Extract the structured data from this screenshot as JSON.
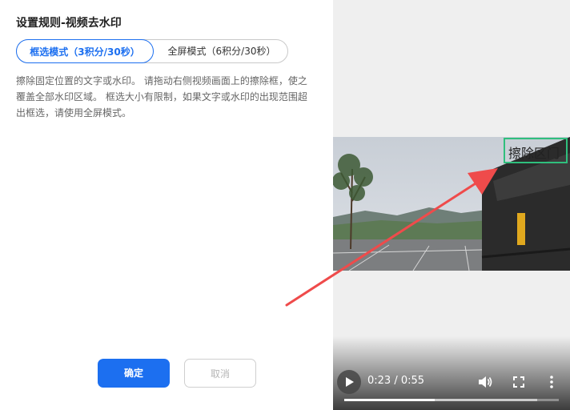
{
  "panel": {
    "title": "设置规则-视频去水印",
    "modes": [
      {
        "label": "框选模式（3积分/30秒）",
        "active": true
      },
      {
        "label": "全屏模式（6积分/30秒）",
        "active": false
      }
    ],
    "description": "擦除固定位置的文字或水印。 请拖动右侧视频画面上的擦除框，使之覆盖全部水印区域。 框选大小有限制，如果文字或水印的出现范围超出框选，请使用全屏模式。",
    "confirm_label": "确定",
    "cancel_label": "取消"
  },
  "player": {
    "erase_box_label": "擦除区门",
    "time_display": "0:23 / 0:55",
    "current_time": "0:23",
    "duration": "0:55",
    "played_fraction": 0.42,
    "buffered_fraction": 0.9
  },
  "colors": {
    "accent": "#1c6ff0",
    "erase_box_border": "#2fbf7d",
    "arrow": "#ef4b4b"
  },
  "icons": [
    "play-icon",
    "volume-icon",
    "fullscreen-icon",
    "more-vert-icon"
  ]
}
